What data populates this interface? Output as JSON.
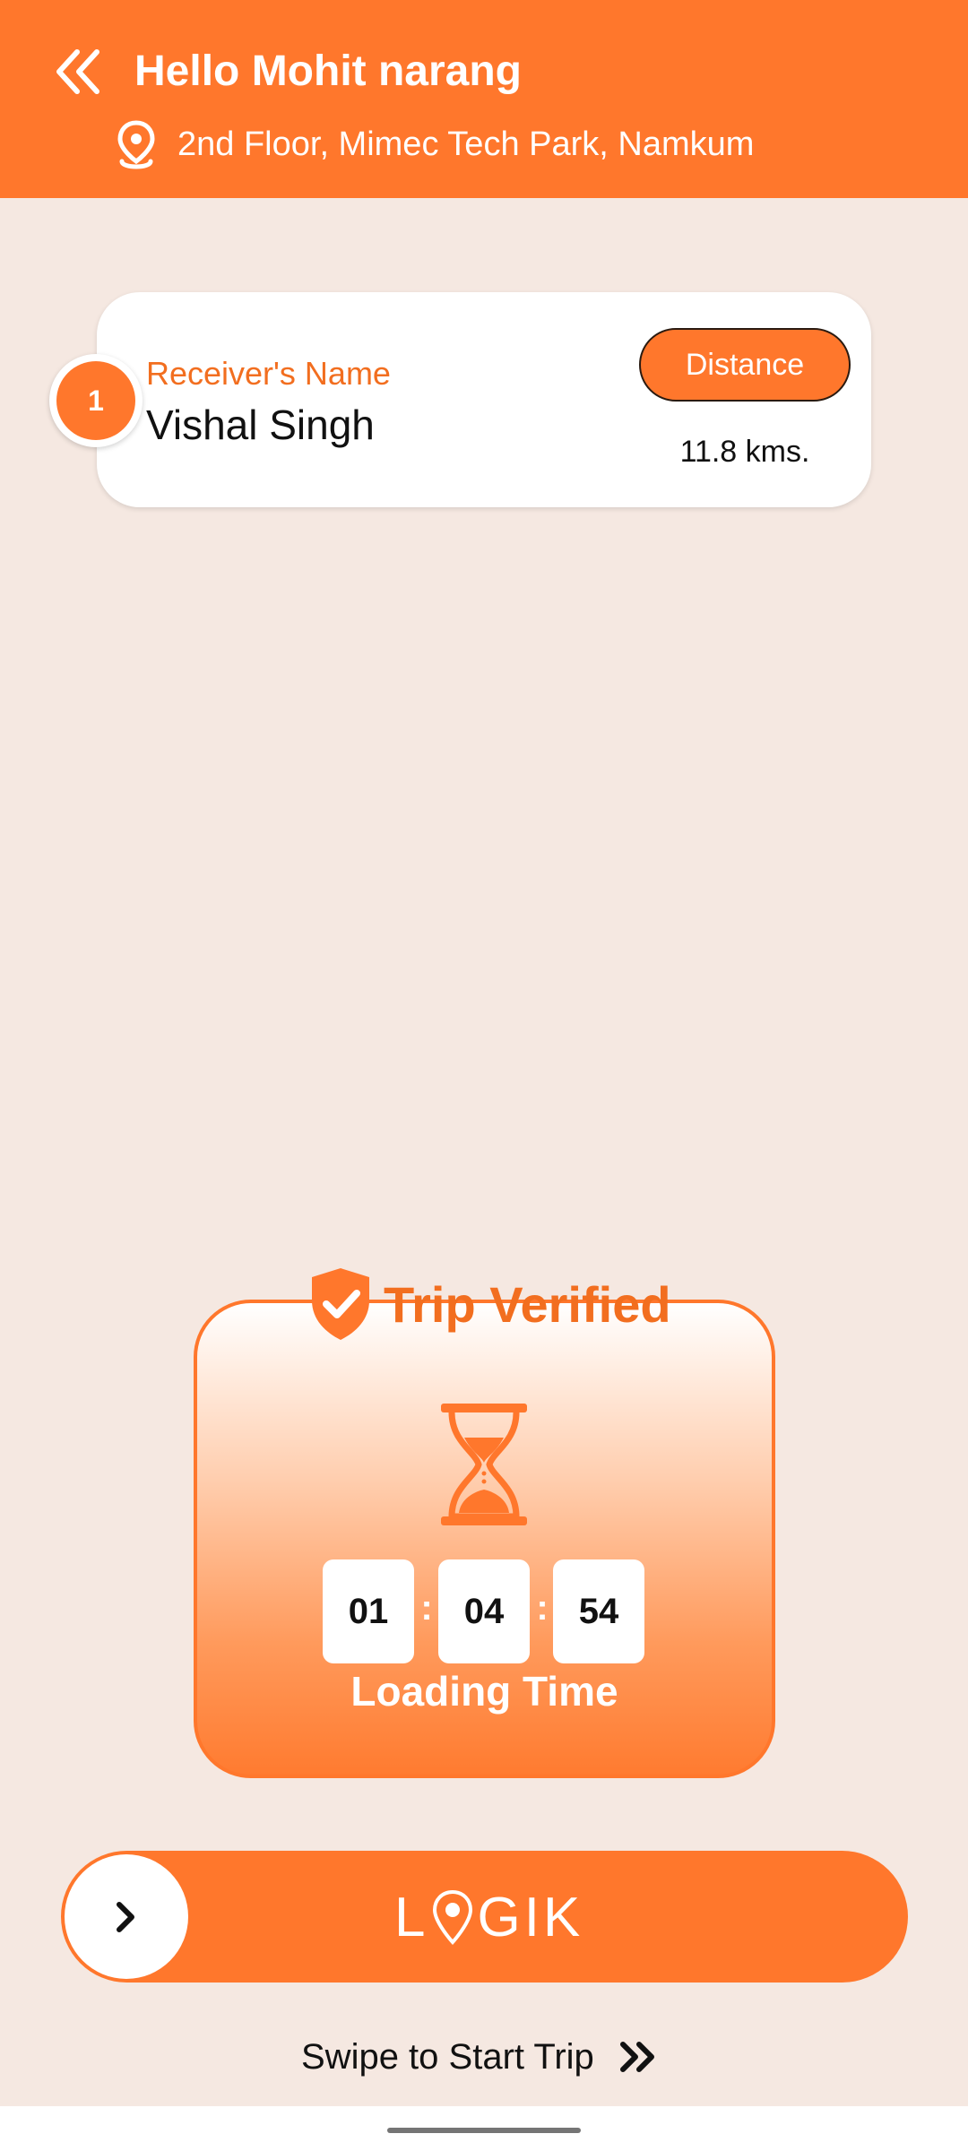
{
  "header": {
    "greeting": "Hello Mohit narang",
    "address": "2nd Floor, Mimec Tech Park, Namkum",
    "back_icon": "double-chevron-left-icon",
    "location_icon": "map-pin-icon"
  },
  "receiver_card": {
    "stop_number": "1",
    "label": "Receiver's Name",
    "name": "Vishal Singh",
    "distance_label": "Distance",
    "distance_value": "11.8 kms."
  },
  "trip_card": {
    "title": "Trip Verified",
    "status_icon": "shield-check-icon",
    "timer_icon": "hourglass-icon",
    "timer": {
      "hours": "01",
      "minutes": "04",
      "seconds": "54",
      "separator": ":"
    },
    "caption": "Loading Time"
  },
  "swipe": {
    "brand_left": "L",
    "brand_right": "GIK",
    "knob_icon": "chevron-right-icon",
    "hint": "Swipe to Start Trip",
    "hint_icon": "double-chevron-right-icon"
  },
  "colors": {
    "accent": "#FF772C",
    "accent_text": "#F26E1F",
    "background": "#F5E8E1"
  }
}
